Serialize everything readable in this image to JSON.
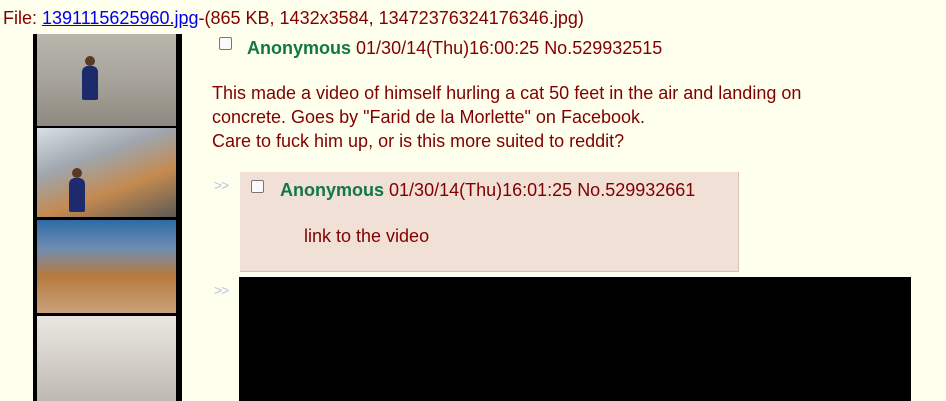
{
  "file": {
    "prefix": "File: ",
    "link": "1391115625960.jpg",
    "details": "-(865 KB, 1432x3584, 13472376324176346.jpg)"
  },
  "op": {
    "name": "Anonymous",
    "datetime": "01/30/14(Thu)16:00:25",
    "post_no": "No.529932515",
    "lines": [
      "This made a video of himself hurling a cat 50 feet in the air and landing on",
      "concrete. Goes by \"Farid de la Morlette\" on Facebook.",
      "Care to fuck him up, or is this more suited to reddit?"
    ]
  },
  "replies": [
    {
      "arrows": ">>",
      "name": "Anonymous",
      "datetime": "01/30/14(Thu)16:01:25",
      "post_no": "No.529932661",
      "comment": "link to the video"
    },
    {
      "arrows": ">>"
    }
  ],
  "colors": {
    "background": "#ffffee",
    "text": "#800000",
    "name": "#117743",
    "reply_bg": "#f0e0d6",
    "link": "#0000ee"
  }
}
